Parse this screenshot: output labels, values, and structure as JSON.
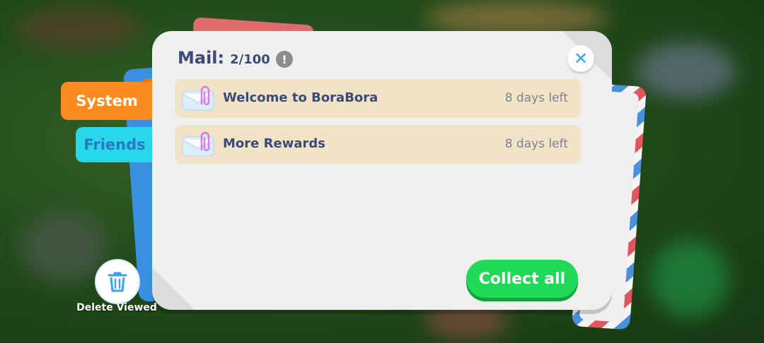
{
  "mail": {
    "title": "Mail:",
    "count": "2/100",
    "info_icon": "!",
    "close_icon": "✕",
    "items": [
      {
        "subject": "Welcome to BoraBora",
        "days_left": "8 days left",
        "icon": "envelope-with-paperclip"
      },
      {
        "subject": "More Rewards",
        "days_left": "8 days left",
        "icon": "envelope-with-paperclip"
      }
    ],
    "collect_label": "Collect all"
  },
  "tabs": {
    "system": "System",
    "friends": "Friends"
  },
  "delete": {
    "label": "Delete Viewed",
    "icon": "trash-icon"
  },
  "colors": {
    "tab_system": "#fb8a1f",
    "tab_friends": "#28d7ea",
    "collect_button": "#1fd957",
    "mail_item_bg": "#f0e3c6",
    "title_text": "#3c4a7a"
  }
}
